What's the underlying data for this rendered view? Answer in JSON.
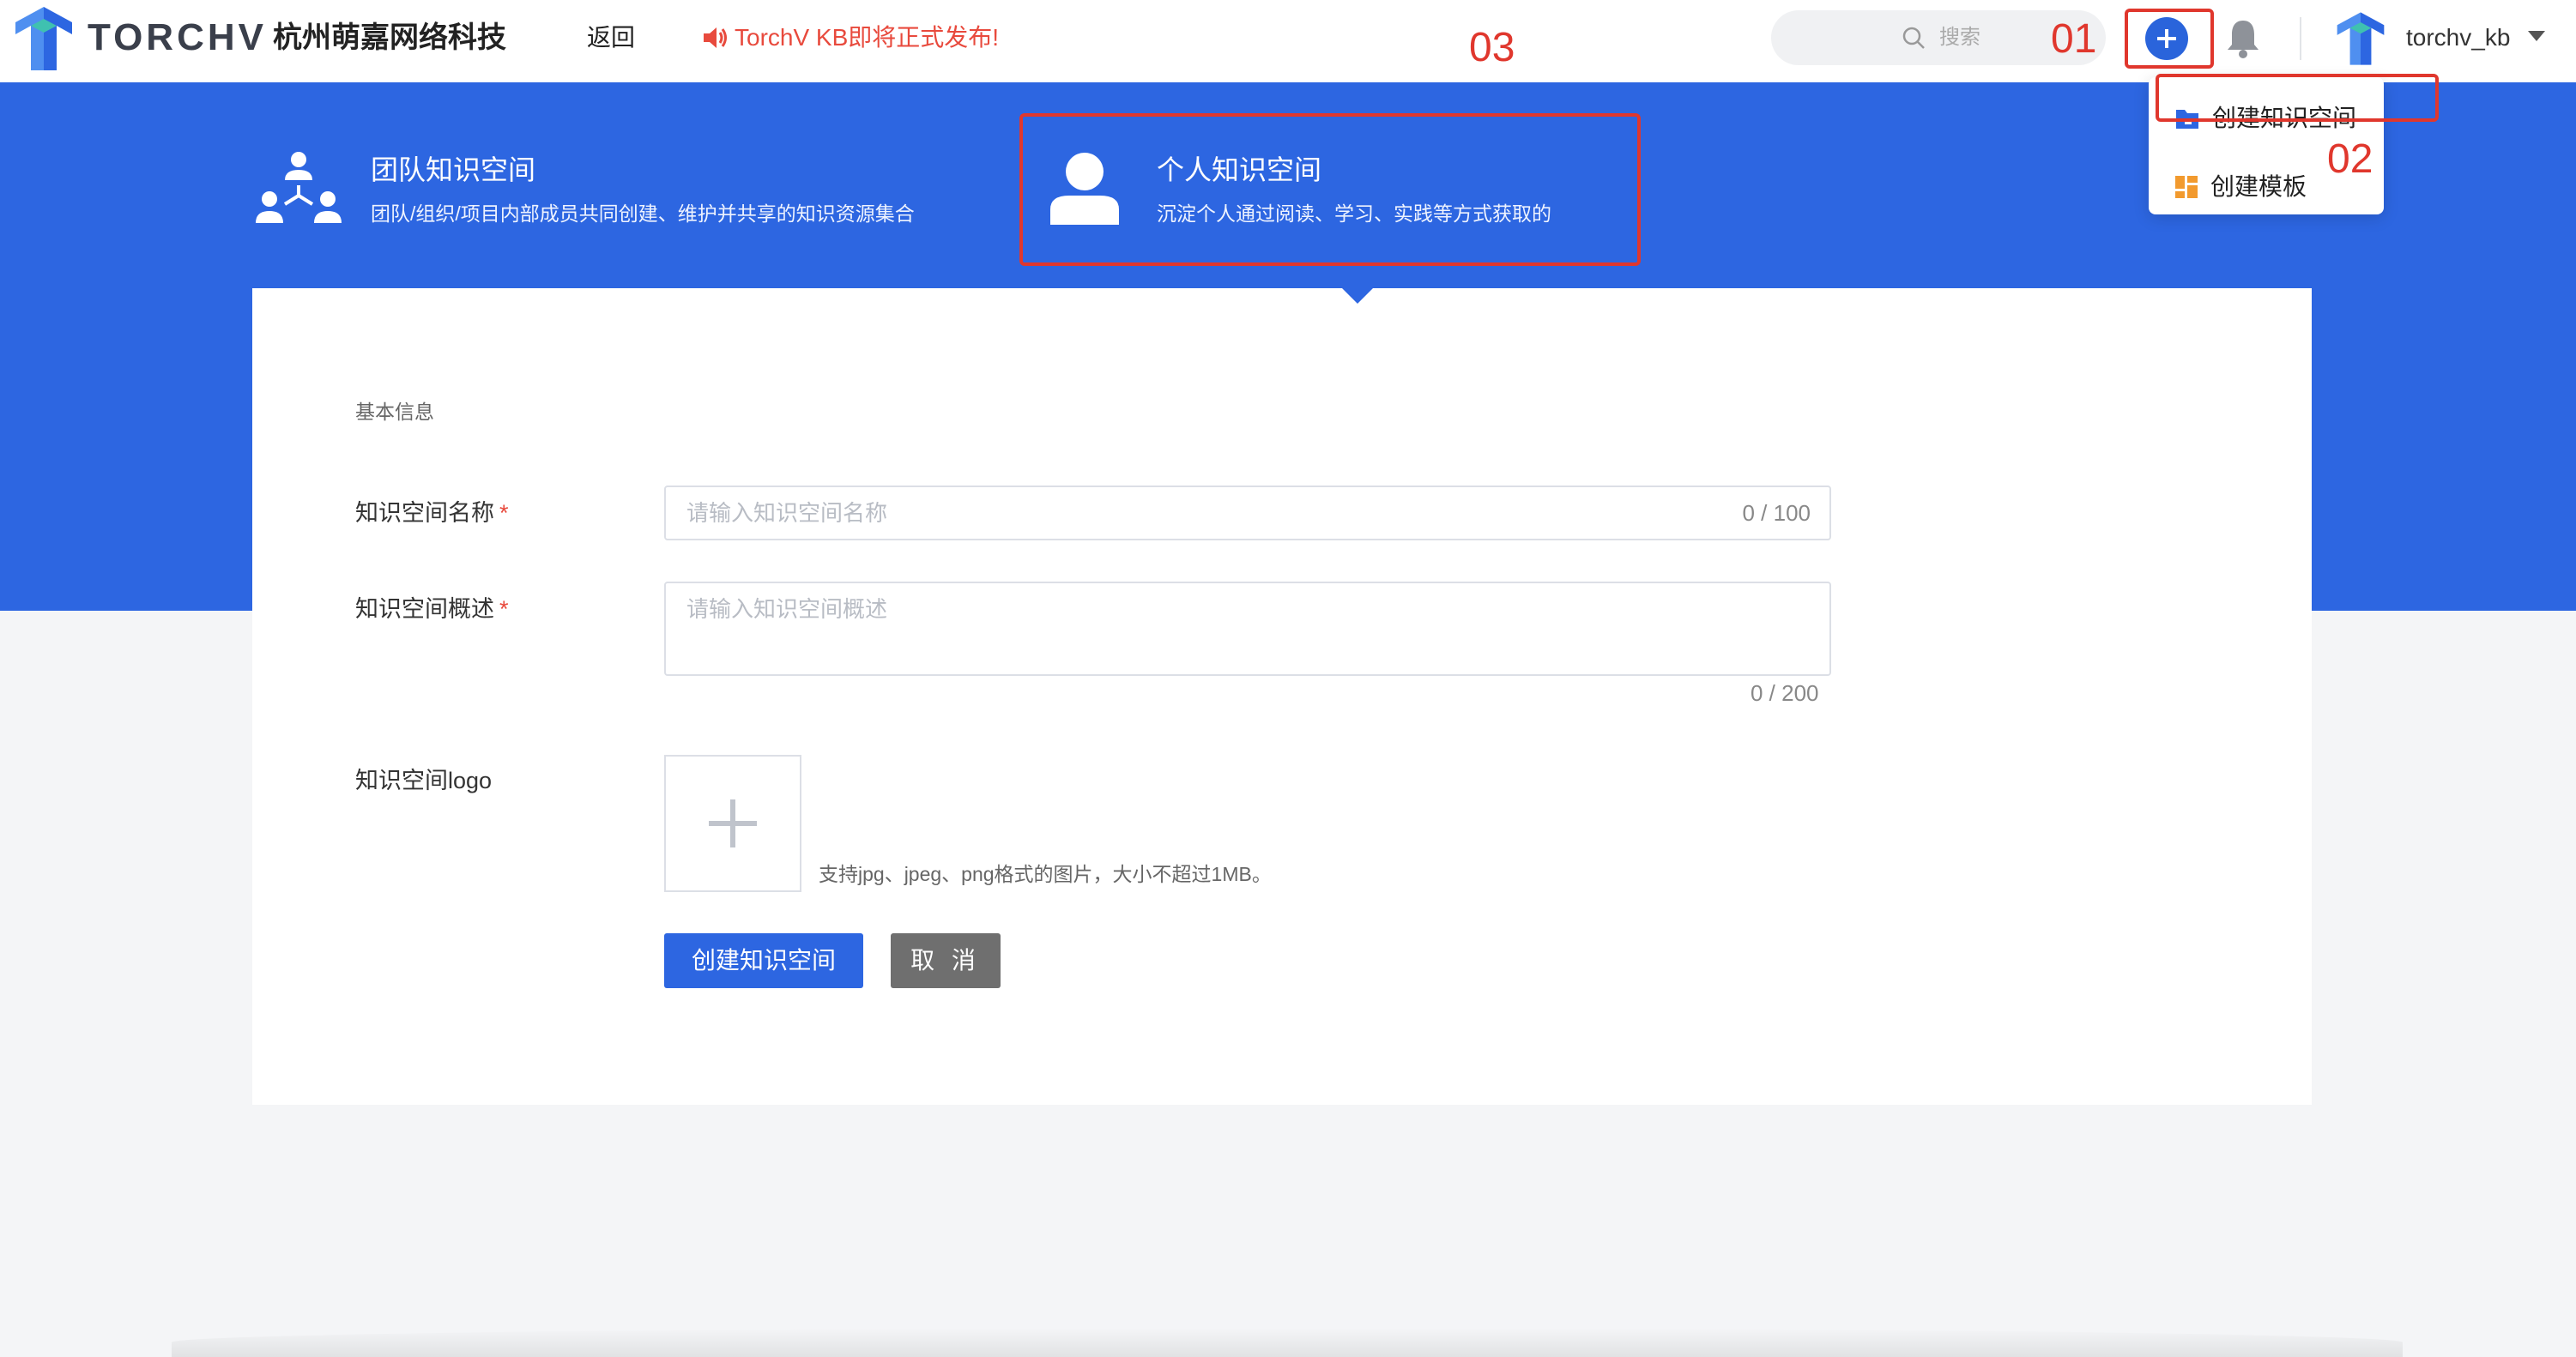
{
  "header": {
    "brand": "TORCHV",
    "company": "杭州萌嘉网络科技",
    "back_label": "返回",
    "announcement": "TorchV KB即将正式发布!",
    "search_placeholder": "搜索",
    "username": "torchv_kb"
  },
  "space_types": [
    {
      "title": "团队知识空间",
      "desc": "团队/组织/项目内部成员共同创建、维护并共享的知识资源集合"
    },
    {
      "title": "个人知识空间",
      "desc": "沉淀个人通过阅读、学习、实践等方式获取的"
    }
  ],
  "form": {
    "section_title": "基本信息",
    "name_label": "知识空间名称",
    "name_placeholder": "请输入知识空间名称",
    "name_counter": "0 / 100",
    "desc_label": "知识空间概述",
    "desc_placeholder": "请输入知识空间概述",
    "desc_counter": "0 / 200",
    "logo_label": "知识空间logo",
    "logo_hint": "支持jpg、jpeg、png格式的图片，大小不超过1MB。",
    "required_mark": "*",
    "submit_label": "创建知识空间",
    "cancel_label": "取 消"
  },
  "dropdown": {
    "items": [
      {
        "label": "创建知识空间"
      },
      {
        "label": "创建模板"
      }
    ]
  },
  "annotations": [
    "01",
    "02",
    "03"
  ],
  "colors": {
    "primary": "#2d66e1",
    "annotation": "#e0372d",
    "announcement": "#e84a3d"
  }
}
